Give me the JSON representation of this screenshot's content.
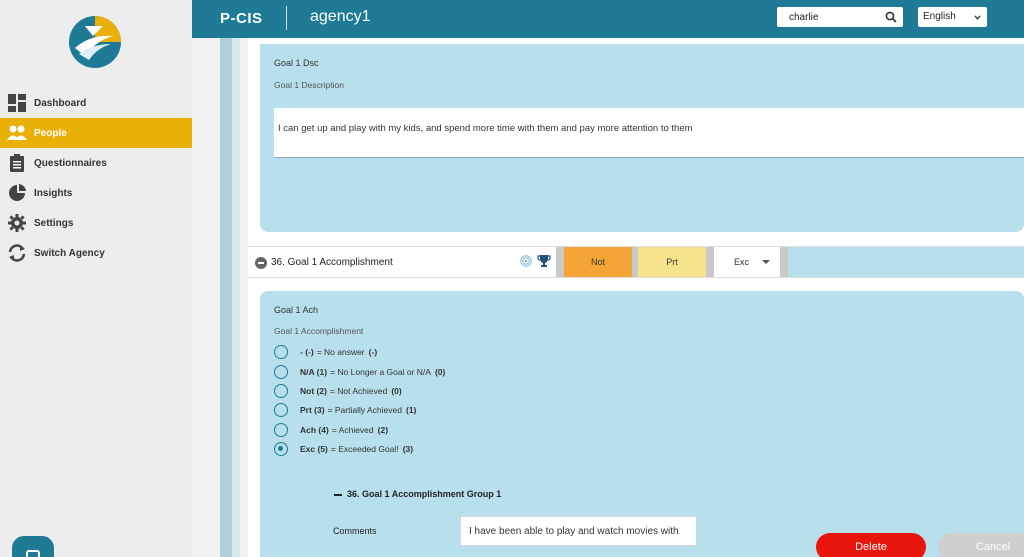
{
  "colors": {
    "header": "#1f7a96",
    "active_nav": "#e9b007",
    "card": "#b7e0ec",
    "not": "#f5a535",
    "prt": "#f7e38c",
    "delete": "#e8150d"
  },
  "header": {
    "brand": "P-CIS",
    "agency": "agency1",
    "search_value": "charlie",
    "search_icon": "search-icon",
    "language": "English"
  },
  "sidebar": {
    "items": [
      {
        "label": "Dashboard",
        "icon": "dashboard-icon"
      },
      {
        "label": "People",
        "icon": "people-icon"
      },
      {
        "label": "Questionnaires",
        "icon": "clipboard-icon"
      },
      {
        "label": "Insights",
        "icon": "pie-chart-icon"
      },
      {
        "label": "Settings",
        "icon": "gear-icon"
      },
      {
        "label": "Switch Agency",
        "icon": "sync-icon"
      }
    ]
  },
  "goal_desc": {
    "title": "Goal 1 Dsc",
    "subtitle": "Goal 1 Description",
    "answer": "I can get up and play with my kids, and spend more time with them and pay more attention to them"
  },
  "question": {
    "title": "36. Goal 1 Accomplishment",
    "chip_not": "Not",
    "chip_prt": "Prt",
    "selected": "Exc"
  },
  "goal_ach": {
    "title": "Goal 1 Ach",
    "subtitle": "Goal 1 Accomplishment",
    "options": [
      {
        "code": "- (-)",
        "text": " = No answer",
        "score": "(-)"
      },
      {
        "code": "N/A (1)",
        "text": " = No Longer a Goal or N/A",
        "score": "(0)"
      },
      {
        "code": "Not (2)",
        "text": " = Not Achieved",
        "score": "(0)"
      },
      {
        "code": "Prt (3)",
        "text": " = Partially Achieved",
        "score": "(1)"
      },
      {
        "code": "Ach (4)",
        "text": " = Achieved",
        "score": "(2)"
      },
      {
        "code": "Exc (5)",
        "text": " = Exceeded Goal!",
        "score": "(3)"
      }
    ],
    "group_title": "36. Goal 1 Accomplishment Group 1",
    "comments_label": "Comments",
    "comments_value": "I have been able to play and watch movies with"
  },
  "actions": {
    "delete": "Delete",
    "cancel": "Cancel"
  }
}
